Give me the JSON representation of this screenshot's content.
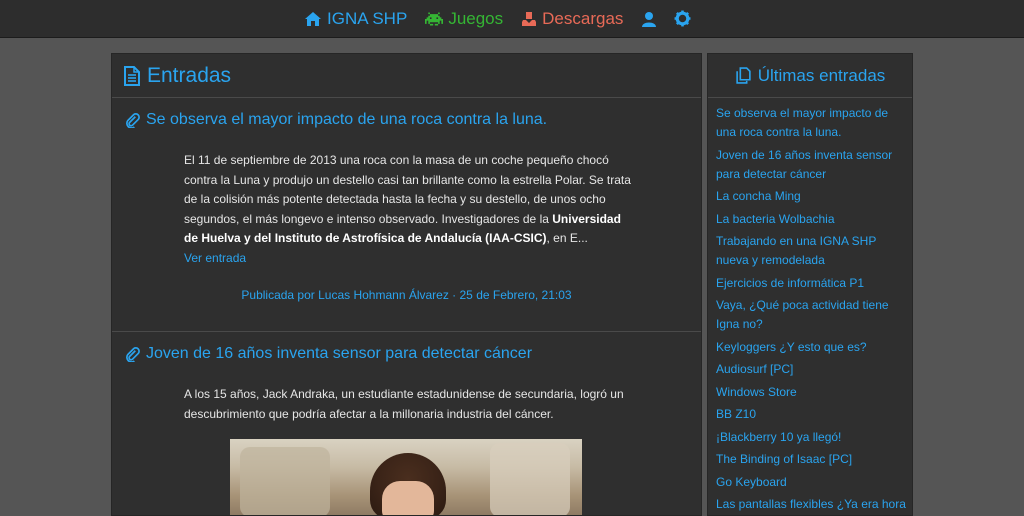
{
  "nav": {
    "home_label": "IGNA SHP",
    "games_label": "Juegos",
    "downloads_label": "Descargas"
  },
  "main": {
    "title": "Entradas",
    "posts": [
      {
        "title": "Se observa el mayor impacto de una roca contra la luna.",
        "text_before": "El 11 de septiembre de 2013 una roca con la masa de un coche pequeño chocó contra la Luna y produjo un destello casi tan brillante como la estrella Polar. Se trata de la colisión más potente detectada hasta la fecha y su destello, de unos ocho segundos, el más longevo e intenso observado. Investigadores de la ",
        "text_bold": "Universidad de Huelva y del Instituto de Astrofísica de Andalucía (IAA-CSIC)",
        "text_after": ", en E...",
        "read_more": "Ver entrada",
        "meta": "Publicada por Lucas Hohmann Álvarez · 25 de Febrero, 21:03"
      },
      {
        "title": "Joven de 16 años inventa sensor para detectar cáncer",
        "text": "A los 15 años, Jack Andraka, un estudiante estadunidense de secundaria, logró un descubrimiento que podría afectar a la millonaria industria del cáncer."
      }
    ]
  },
  "sidebar": {
    "title": "Últimas entradas",
    "items": [
      "Se observa el mayor impacto de una roca contra la luna.",
      "Joven de 16 años inventa sensor para detectar cáncer",
      "La concha Ming",
      "La bacteria Wolbachia",
      "Trabajando en una IGNA SHP nueva y remodelada",
      "Ejercicios de informática P1",
      "Vaya, ¿Qué poca actividad tiene Igna no?",
      "Keyloggers ¿Y esto que es?",
      "Audiosurf [PC]",
      "Windows Store",
      "BB Z10",
      "¡Blackberry 10 ya llegó!",
      "The Binding of Isaac [PC]",
      "Go Keyboard",
      "Las pantallas flexibles ¿Ya era hora"
    ]
  },
  "colors": {
    "accent": "#2aa4ef",
    "games": "#35b534",
    "downloads": "#e86a57",
    "panel": "#2f2f2f",
    "background": "#555555",
    "topbar": "#2d2d2d"
  },
  "icons": {
    "home": "home-icon",
    "games": "space-invader-icon",
    "downloads": "download-tray-icon",
    "user": "user-icon",
    "settings": "gear-icon",
    "entries": "document-icon",
    "latest": "copy-documents-icon",
    "post": "paperclip-icon"
  }
}
